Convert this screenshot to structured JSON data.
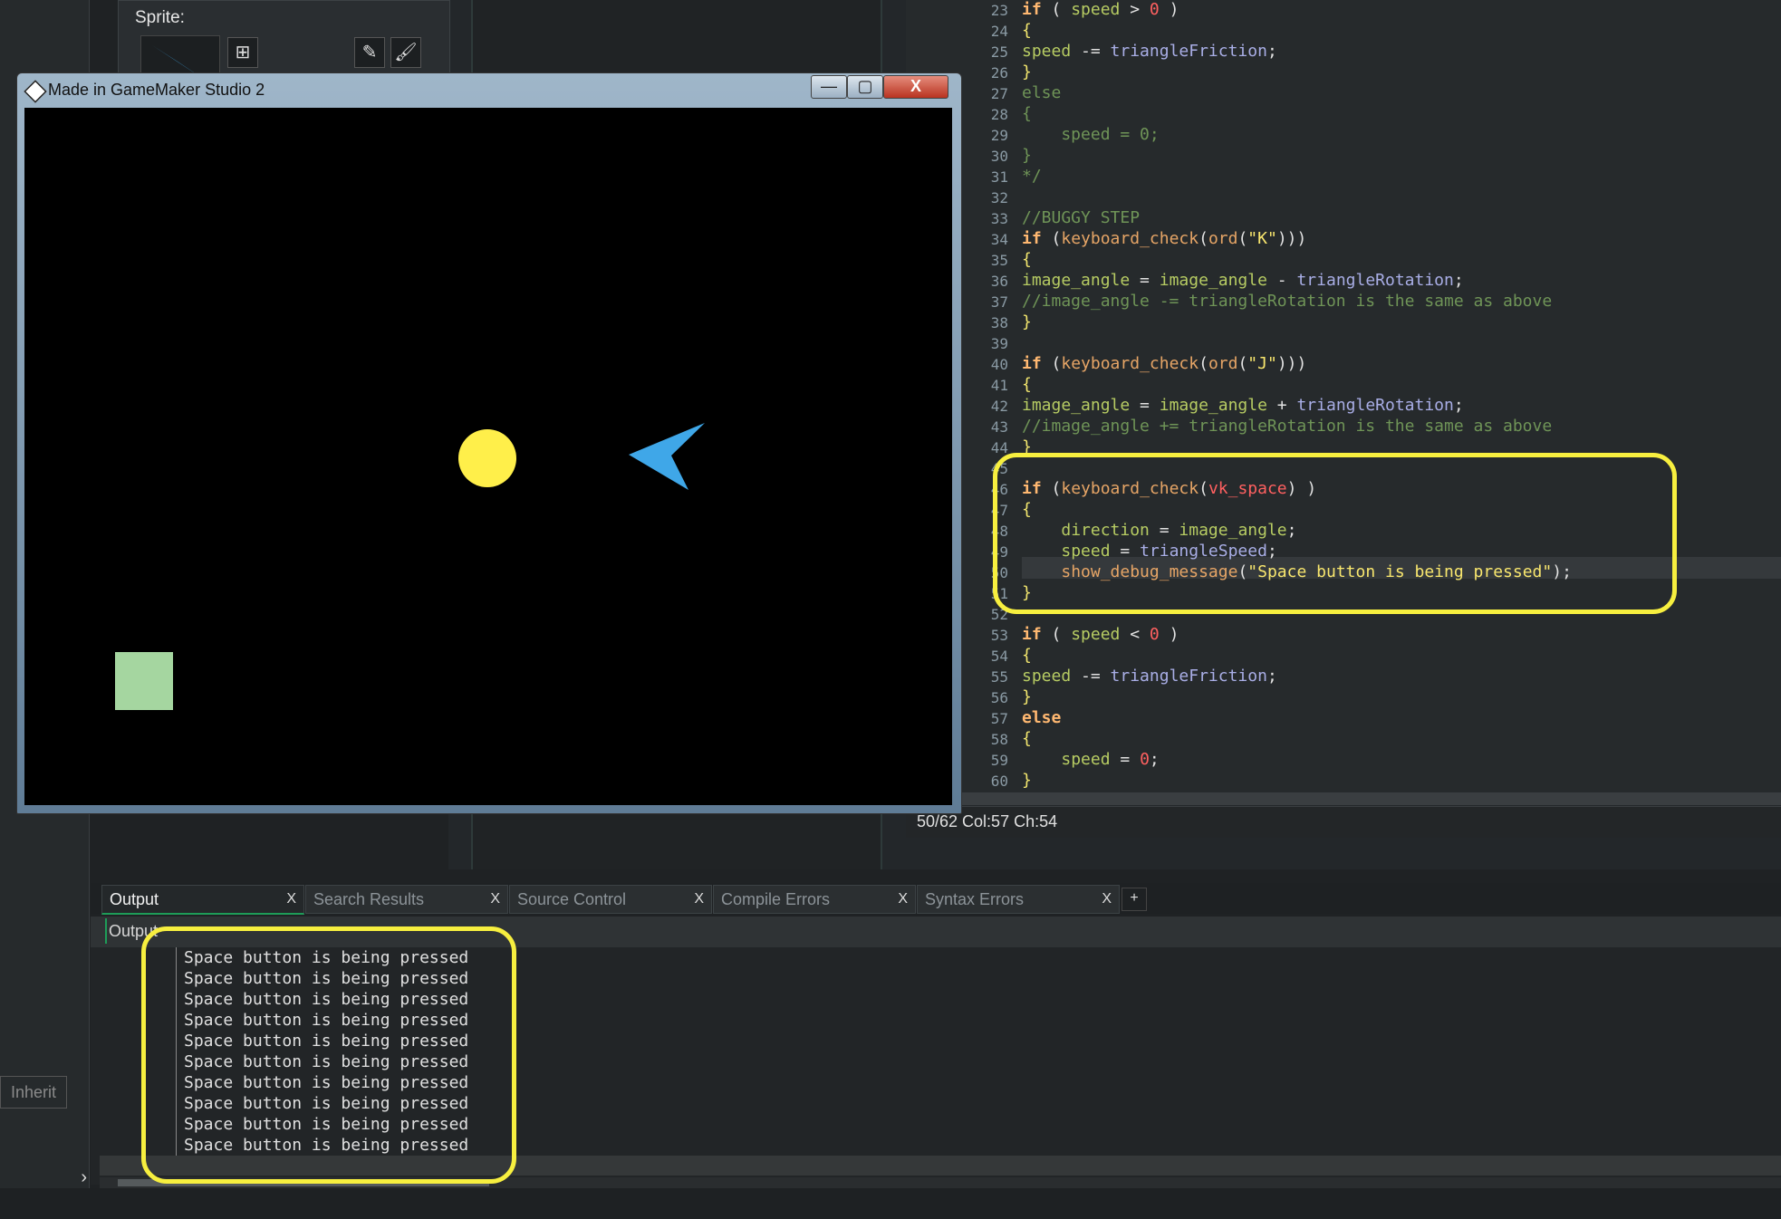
{
  "object_panel": {
    "sprite_label": "Sprite:"
  },
  "game_window": {
    "title": "Made in GameMaker Studio 2",
    "minimize": "—",
    "maximize": "▢",
    "close": "X"
  },
  "editor": {
    "lines": [
      {
        "n": "23",
        "html": "<span class='kw'>if</span> ( <span class='vr'>speed</span> > <span class='nm'>0</span> )"
      },
      {
        "n": "24",
        "html": "<span class='br'>{</span>"
      },
      {
        "n": "25",
        "html": "<span class='vr'>speed</span> -= <span class='bi'>triangleFriction</span>;"
      },
      {
        "n": "26",
        "html": "<span class='br'>}</span>"
      },
      {
        "n": "27",
        "html": "<span class='cm'>else</span>"
      },
      {
        "n": "28",
        "html": "<span class='cm'>{</span>"
      },
      {
        "n": "29",
        "html": "<span class='cm'>    speed = 0;</span>"
      },
      {
        "n": "30",
        "html": "<span class='cm'>}</span>"
      },
      {
        "n": "31",
        "html": "<span class='cm'>*/</span>"
      },
      {
        "n": "32",
        "html": ""
      },
      {
        "n": "33",
        "html": "<span class='cm'>//BUGGY STEP</span>"
      },
      {
        "n": "34",
        "html": "<span class='kw'>if</span> (<span class='fn'>keyboard_check</span>(<span class='fn'>ord</span>(<span class='st'>\"K\"</span>)))"
      },
      {
        "n": "35",
        "html": "<span class='br'>{</span>"
      },
      {
        "n": "36",
        "html": "<span class='vr'>image_angle</span> = <span class='vr'>image_angle</span> - <span class='bi'>triangleRotation</span>;"
      },
      {
        "n": "37",
        "html": "<span class='cm'>//image_angle -= triangleRotation is the same as above</span>"
      },
      {
        "n": "38",
        "html": "<span class='br'>}</span>"
      },
      {
        "n": "39",
        "html": ""
      },
      {
        "n": "40",
        "html": "<span class='kw'>if</span> (<span class='fn'>keyboard_check</span>(<span class='fn'>ord</span>(<span class='st'>\"J\"</span>)))"
      },
      {
        "n": "41",
        "html": "<span class='br'>{</span>"
      },
      {
        "n": "42",
        "html": "<span class='vr'>image_angle</span> = <span class='vr'>image_angle</span> + <span class='bi'>triangleRotation</span>;"
      },
      {
        "n": "43",
        "html": "<span class='cm'>//image_angle += triangleRotation is the same as above</span>"
      },
      {
        "n": "44",
        "html": "<span class='br'>}</span>"
      },
      {
        "n": "45",
        "html": ""
      },
      {
        "n": "46",
        "html": "<span class='kw'>if</span> (<span class='fn'>keyboard_check</span>(<span class='nm'>vk_space</span>) )"
      },
      {
        "n": "47",
        "html": "<span class='br'>{</span>"
      },
      {
        "n": "48",
        "html": "    <span class='vr'>direction</span> = <span class='vr'>image_angle</span>;"
      },
      {
        "n": "49",
        "html": "    <span class='vr'>speed</span> = <span class='bi'>triangleSpeed</span>;"
      },
      {
        "n": "50",
        "html": "    <span class='fn'>show_debug_message</span>(<span class='st'>\"Space button is being pressed\"</span>);"
      },
      {
        "n": "51",
        "html": "<span class='br'>}</span>"
      },
      {
        "n": "52",
        "html": ""
      },
      {
        "n": "53",
        "html": "<span class='kw'>if</span> ( <span class='vr'>speed</span> < <span class='nm'>0</span> )"
      },
      {
        "n": "54",
        "html": "<span class='br'>{</span>"
      },
      {
        "n": "55",
        "html": "<span class='vr'>speed</span> -= <span class='bi'>triangleFriction</span>;"
      },
      {
        "n": "56",
        "html": "<span class='br'>}</span>"
      },
      {
        "n": "57",
        "html": "<span class='kw'>else</span>"
      },
      {
        "n": "58",
        "html": "<span class='br'>{</span>"
      },
      {
        "n": "59",
        "html": "    <span class='vr'>speed</span> = <span class='nm'>0</span>;"
      },
      {
        "n": "60",
        "html": "<span class='br'>}</span>"
      }
    ],
    "status": "50/62 Col:57 Ch:54"
  },
  "output_tabs": [
    {
      "label": "Output",
      "close": "X"
    },
    {
      "label": "Search Results",
      "close": "X"
    },
    {
      "label": "Source Control",
      "close": "X"
    },
    {
      "label": "Compile Errors",
      "close": "X"
    },
    {
      "label": "Syntax Errors",
      "close": "X"
    }
  ],
  "add_tab": "+",
  "output": {
    "header": "Output",
    "lines": [
      "Space button is being pressed",
      "Space button is being pressed",
      "Space button is being pressed",
      "Space button is being pressed",
      "Space button is being pressed",
      "Space button is being pressed",
      "Space button is being pressed",
      "Space button is being pressed",
      "Space button is being pressed",
      "Space button is being pressed"
    ]
  },
  "side": {
    "inherit": "Inherit",
    "expand": "›"
  },
  "colors": {
    "highlight": "#f7ef3f",
    "triangle": "#3fa7e8",
    "circle": "#ffef4a",
    "square": "#a5d6a0"
  }
}
